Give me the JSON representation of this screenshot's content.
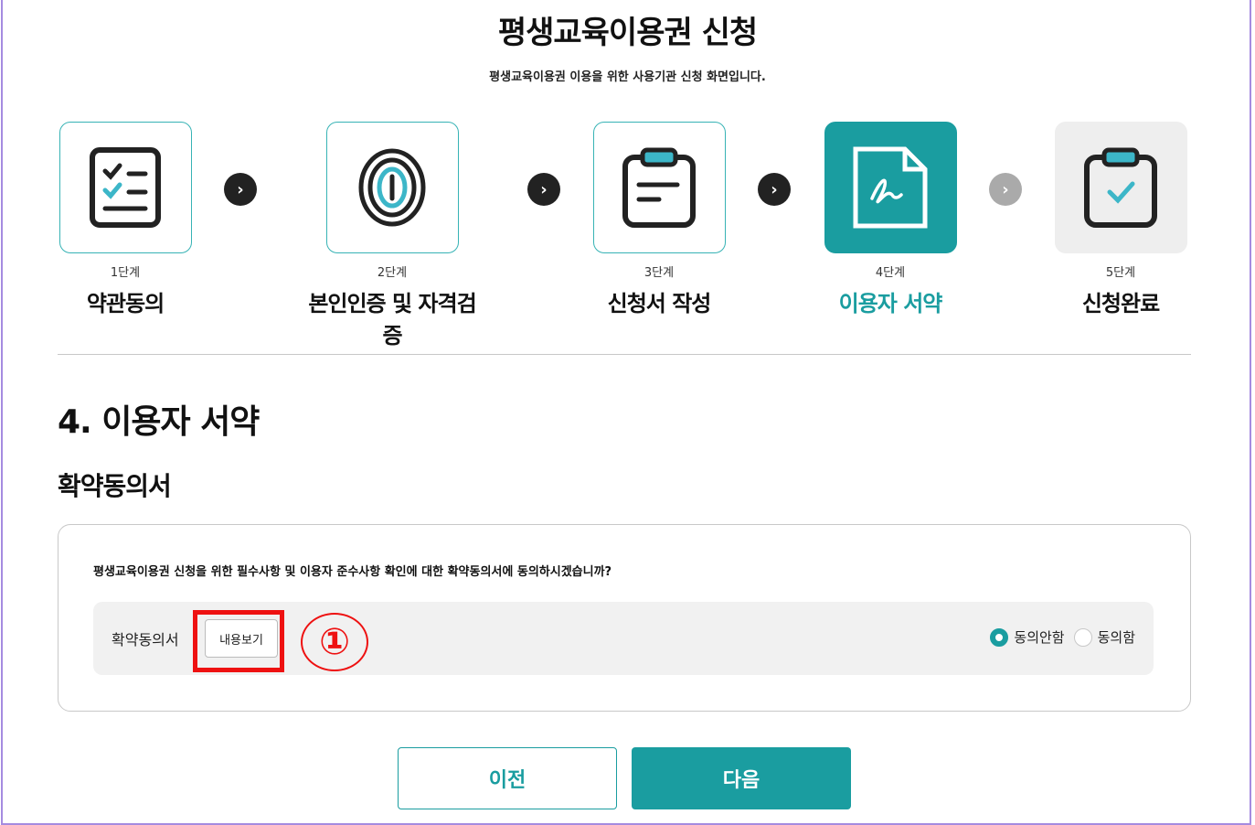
{
  "page": {
    "title": "평생교육이용권 신청",
    "subtitle": "평생교육이용권 이용을 위한 사용기관 신청 화면입니다."
  },
  "steps": [
    {
      "num": "1단계",
      "label": "약관동의",
      "icon": "checklist-icon",
      "state": "done"
    },
    {
      "num": "2단계",
      "label": "본인인증 및 자격검증",
      "icon": "fingerprint-icon",
      "state": "done"
    },
    {
      "num": "3단계",
      "label": "신청서 작성",
      "icon": "clipboard-icon",
      "state": "done"
    },
    {
      "num": "4단계",
      "label": "이용자 서약",
      "icon": "signature-document-icon",
      "state": "active"
    },
    {
      "num": "5단계",
      "label": "신청완료",
      "icon": "clipboard-check-icon",
      "state": "pending"
    }
  ],
  "section": {
    "title": "4. 이용자 서약",
    "subtitle": "확약동의서"
  },
  "agreement": {
    "question": "평생교육이용권 신청을 위한 필수사항 및 이용자 준수사항 확인에 대한 확약동의서에 동의하시겠습니까?",
    "label": "확약동의서",
    "view_button": "내용보기",
    "options": [
      {
        "label": "동의안함",
        "checked": true
      },
      {
        "label": "동의함",
        "checked": false
      }
    ]
  },
  "annotation": {
    "callout": "①",
    "color": "#ee1111"
  },
  "buttons": {
    "prev": "이전",
    "next": "다음"
  },
  "colors": {
    "accent": "#1a9da0",
    "frame": "#a58be0"
  }
}
